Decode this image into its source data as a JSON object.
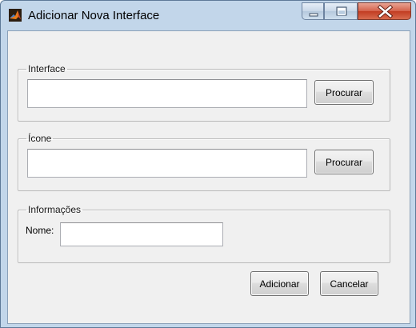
{
  "window": {
    "title": "Adicionar Nova Interface",
    "icons": {
      "app": "matlab-logo-icon",
      "minimize": "minimize-icon",
      "maximize": "maximize-icon",
      "close": "close-icon"
    }
  },
  "interface_group": {
    "legend": "Interface",
    "path_value": "",
    "browse_label": "Procurar"
  },
  "icon_group": {
    "legend": "Ícone",
    "path_value": "",
    "browse_label": "Procurar"
  },
  "info_group": {
    "legend": "Informações",
    "name_label": "Nome:",
    "name_value": ""
  },
  "actions": {
    "add_label": "Adicionar",
    "cancel_label": "Cancelar"
  },
  "colors": {
    "frame": "#c2d6ea",
    "client": "#f0f0f0",
    "close_button": "#c9432a"
  }
}
